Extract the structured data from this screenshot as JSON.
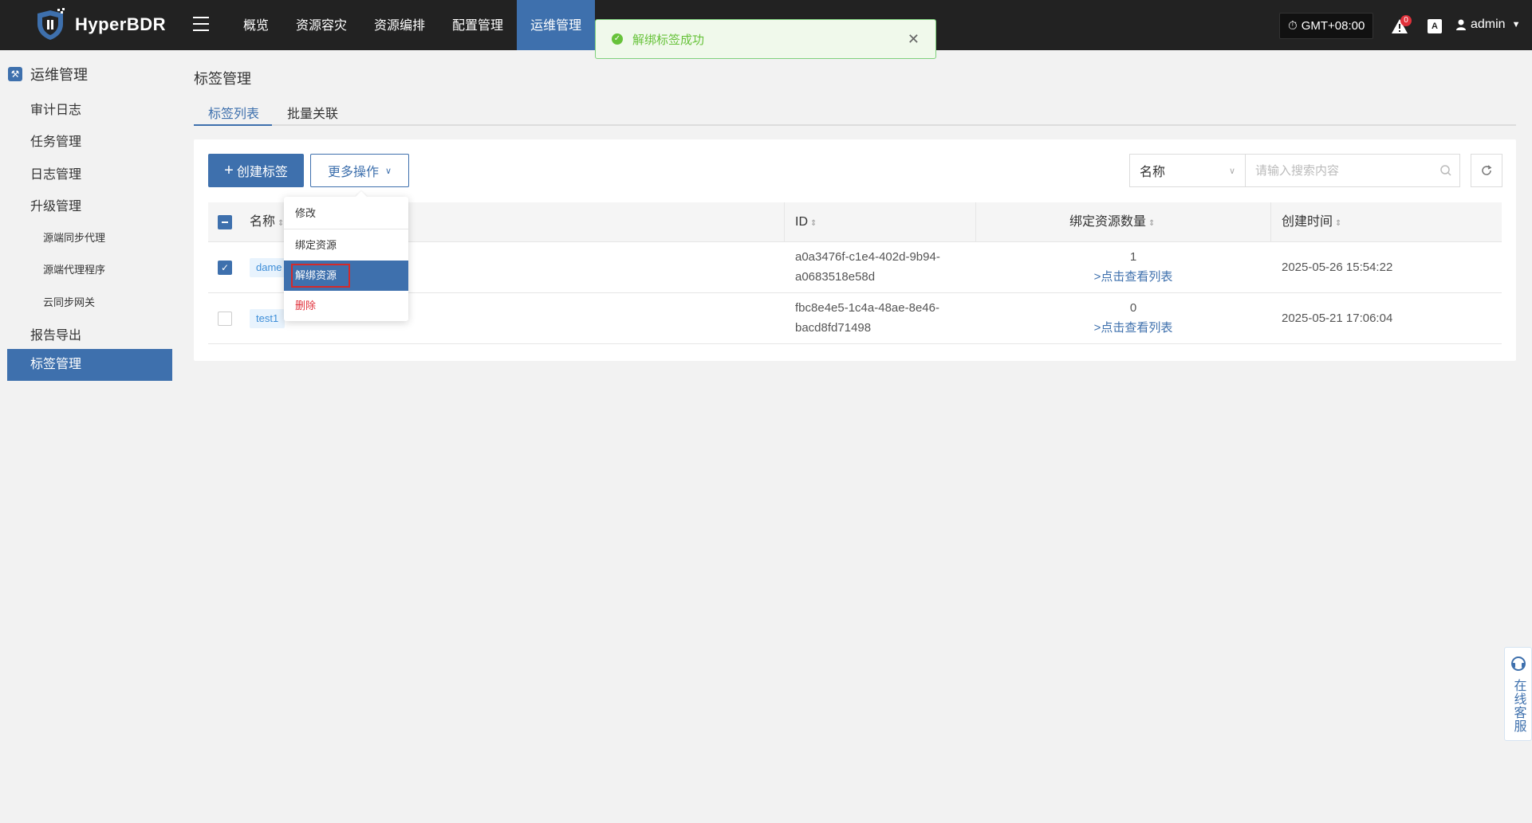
{
  "app": {
    "name": "HyperBDR"
  },
  "nav": {
    "items": [
      {
        "label": "概览"
      },
      {
        "label": "资源容灾"
      },
      {
        "label": "资源编排"
      },
      {
        "label": "配置管理"
      },
      {
        "label": "运维管理"
      }
    ],
    "active_index": 4
  },
  "toast": {
    "message": "解绑标签成功"
  },
  "header": {
    "timezone": "GMT+08:00",
    "alerts_count": "0",
    "language_icon_text": "A",
    "user": "admin"
  },
  "sidebar": {
    "section_title": "运维管理",
    "items": [
      {
        "label": "审计日志"
      },
      {
        "label": "任务管理"
      },
      {
        "label": "日志管理"
      },
      {
        "label": "升级管理"
      },
      {
        "label": "源端同步代理"
      },
      {
        "label": "源端代理程序"
      },
      {
        "label": "云同步网关"
      },
      {
        "label": "报告导出"
      },
      {
        "label": "标签管理"
      }
    ]
  },
  "page": {
    "title": "标签管理",
    "tabs": [
      {
        "label": "标签列表"
      },
      {
        "label": "批量关联"
      }
    ]
  },
  "toolbar": {
    "create_label": "创建标签",
    "more_label": "更多操作",
    "search_field": "名称",
    "search_placeholder": "请输入搜索内容"
  },
  "menu": {
    "items": [
      {
        "label": "修改"
      },
      {
        "label": "绑定资源"
      },
      {
        "label": "解绑资源"
      },
      {
        "label": "删除"
      }
    ]
  },
  "table": {
    "columns": [
      {
        "label": "名称"
      },
      {
        "label": "ID"
      },
      {
        "label": "绑定资源数量"
      },
      {
        "label": "创建时间"
      }
    ],
    "view_list_label": ">点击查看列表",
    "rows": [
      {
        "name": "dame",
        "checked": true,
        "id_line1": "a0a3476f-c1e4-402d-9b94-",
        "id_line2": "a0683518e58d",
        "count": "1",
        "created": "2025-05-26 15:54:22"
      },
      {
        "name": "test1",
        "checked": false,
        "id_line1": "fbc8e4e5-1c4a-48ae-8e46-",
        "id_line2": "bacd8fd71498",
        "count": "0",
        "created": "2025-05-21 17:06:04"
      }
    ]
  },
  "service": {
    "label": "在线客服"
  },
  "colors": {
    "brand": "#3e70ad",
    "topbar": "#222222",
    "success": "#67c23a",
    "danger": "#e0303a"
  }
}
